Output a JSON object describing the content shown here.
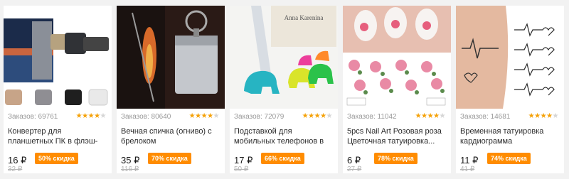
{
  "products": [
    {
      "orders": "Заказов: 69761",
      "rating_stars": 4,
      "title": "Конвертер для планшетных ПК в флэш-мышь",
      "price": "16 ₽",
      "discount": "50% скидка",
      "old_price": "32 ₽",
      "image": "usb-otg-adapter-icon"
    },
    {
      "orders": "Заказов: 80640",
      "rating_stars": 4,
      "title": "Вечная спичка (огниво) с брелоком",
      "price": "35 ₽",
      "discount": "70% скидка",
      "old_price": "116 ₽",
      "image": "eternal-match-icon"
    },
    {
      "orders": "Заказов: 72079",
      "rating_stars": 4,
      "title": "Подставкой для мобильных телефонов в форме слона",
      "price": "17 ₽",
      "discount": "66% скидка",
      "old_price": "50 ₽",
      "image": "elephant-phone-stand-icon",
      "image_text": "Anna Karenina"
    },
    {
      "orders": "Заказов: 11042",
      "rating_stars": 4,
      "title": "5pcs Nail Art Розовая роза Цветочная татуировка...",
      "price": "6 ₽",
      "discount": "78% скидка",
      "old_price": "27 ₽",
      "image": "nail-art-roses-icon"
    },
    {
      "orders": "Заказов: 14681",
      "rating_stars": 4,
      "title": "Временная татуировка кардиограмма",
      "price": "11 ₽",
      "discount": "74% скидка",
      "old_price": "41 ₽",
      "image": "cardiogram-tattoo-icon"
    }
  ],
  "colors": {
    "discount_bg": "#ff8c00",
    "star": "#f5a20a",
    "page_bg": "#f2f2f2"
  }
}
